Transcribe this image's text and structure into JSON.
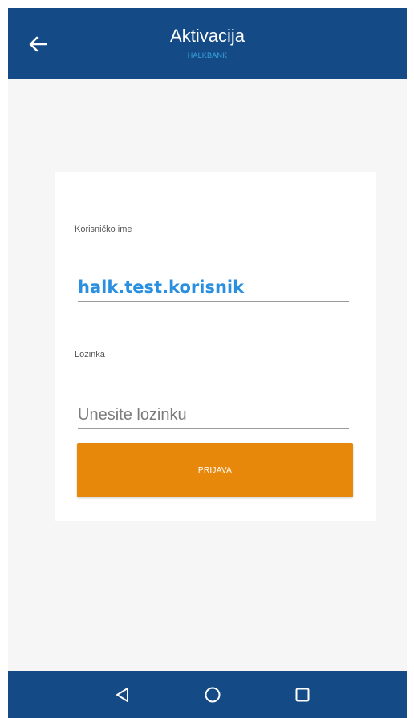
{
  "header": {
    "title": "Aktivacija",
    "subtitle": "HALKBANK",
    "back_icon": "arrow-left-icon"
  },
  "form": {
    "username_label": "Korisničko ime",
    "username_value": "halk.test.korisnik",
    "password_label": "Lozinka",
    "password_placeholder": "Unesite lozinku",
    "submit_label": "PRIJAVA"
  },
  "navbar": {
    "icons": [
      "nav-back-icon",
      "nav-home-icon",
      "nav-recents-icon"
    ]
  },
  "colors": {
    "primary": "#144a86",
    "accent": "#e8880a",
    "subtitle": "#3aa6e0",
    "input_value": "#2b8fe0"
  }
}
